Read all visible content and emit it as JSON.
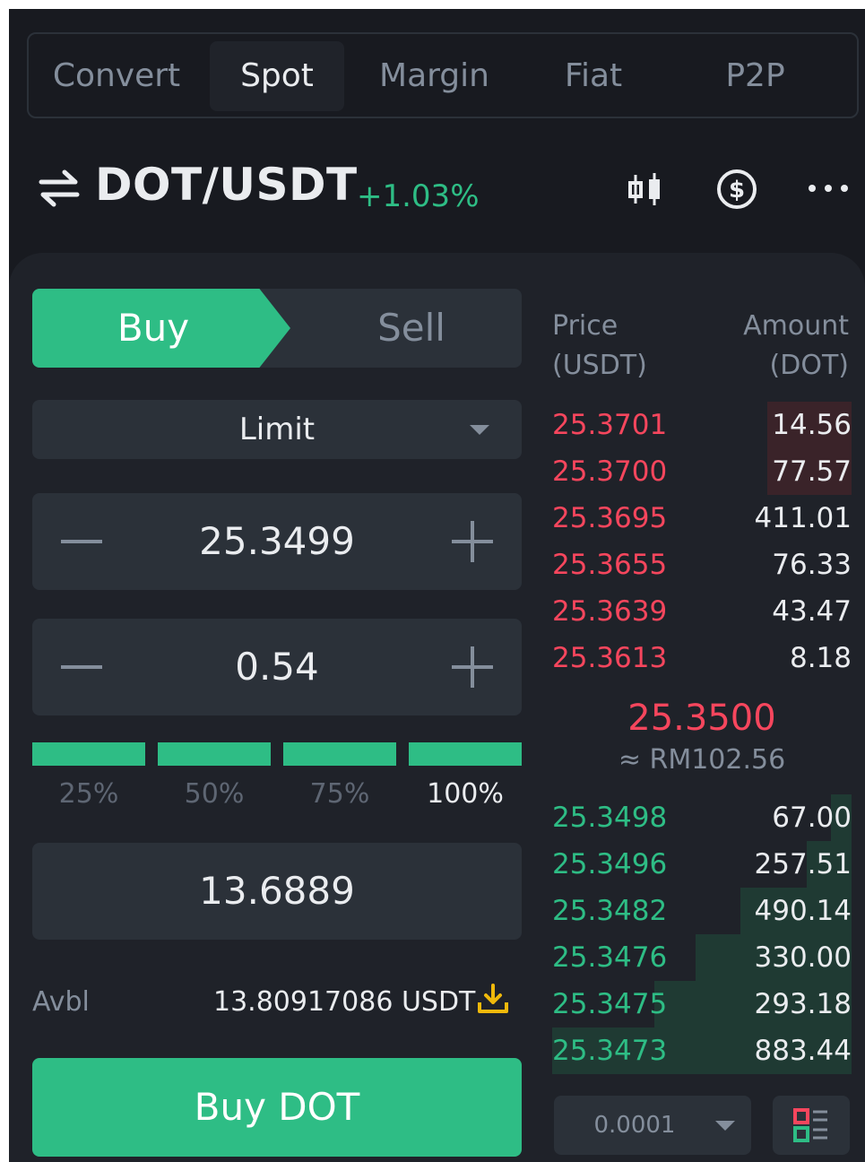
{
  "tabs": [
    "Convert",
    "Spot",
    "Margin",
    "Fiat",
    "P2P"
  ],
  "active_tab": "Spot",
  "pair": {
    "name": "DOT/USDT",
    "change": "+1.03%"
  },
  "icons": {
    "swap": "swap-arrows-icon",
    "chart": "candlestick-icon",
    "currency": "dollar-circle-icon",
    "more": "more-dots-icon"
  },
  "order_form": {
    "buy_label": "Buy",
    "sell_label": "Sell",
    "order_type": "Limit",
    "price": "25.3499",
    "amount": "0.54",
    "percentages": [
      "25%",
      "50%",
      "75%",
      "100%"
    ],
    "selected_percentage": "100%",
    "total": "13.6889",
    "avbl_label": "Avbl",
    "avbl_value": "13.80917086 USDT",
    "submit_label": "Buy DOT"
  },
  "order_book": {
    "price_header_1": "Price",
    "price_header_2": "(USDT)",
    "amount_header_1": "Amount",
    "amount_header_2": "(DOT)",
    "asks": [
      {
        "price": "25.3701",
        "amount": "14.56",
        "depth": 0.28
      },
      {
        "price": "25.3700",
        "amount": "77.57",
        "depth": 0.28
      },
      {
        "price": "25.3695",
        "amount": "411.01",
        "depth": 0.0
      },
      {
        "price": "25.3655",
        "amount": "76.33",
        "depth": 0.0
      },
      {
        "price": "25.3639",
        "amount": "43.47",
        "depth": 0.0
      },
      {
        "price": "25.3613",
        "amount": "8.18",
        "depth": 0.0
      }
    ],
    "last_price": "25.3500",
    "last_price_fiat": "≈ RM102.56",
    "bids": [
      {
        "price": "25.3498",
        "amount": "67.00",
        "depth": 0.07
      },
      {
        "price": "25.3496",
        "amount": "257.51",
        "depth": 0.15
      },
      {
        "price": "25.3482",
        "amount": "490.14",
        "depth": 0.37
      },
      {
        "price": "25.3476",
        "amount": "330.00",
        "depth": 0.52
      },
      {
        "price": "25.3475",
        "amount": "293.18",
        "depth": 0.66
      },
      {
        "price": "25.3473",
        "amount": "883.44",
        "depth": 1.0
      }
    ],
    "tick_size": "0.0001"
  },
  "colors": {
    "up": "#2ebd85",
    "down": "#f6465d",
    "background": "#181a20",
    "panel": "#1f2229",
    "accent": "#f0b90b"
  }
}
